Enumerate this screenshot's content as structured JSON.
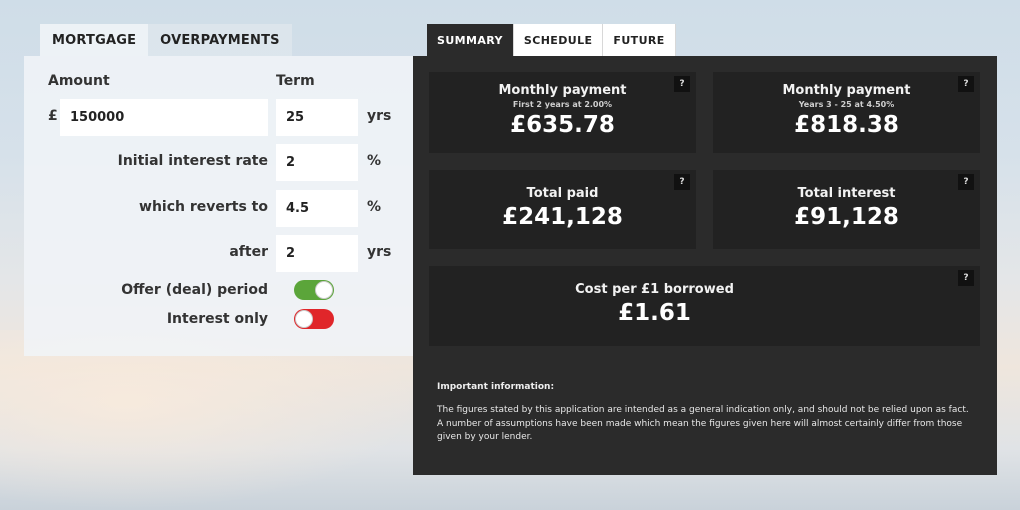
{
  "left_tabs": [
    {
      "label": "MORTGAGE",
      "active": true
    },
    {
      "label": "OVERPAYMENTS",
      "active": false
    }
  ],
  "form": {
    "amount_label": "Amount",
    "term_label": "Term",
    "currency_symbol": "£",
    "amount_value": "150000",
    "term_value": "25",
    "term_unit": "yrs",
    "initial_rate_label": "Initial interest rate",
    "initial_rate_value": "2",
    "initial_rate_unit": "%",
    "reverts_label": "which reverts to",
    "reverts_value": "4.5",
    "reverts_unit": "%",
    "after_label": "after",
    "after_value": "2",
    "after_unit": "yrs",
    "offer_label": "Offer (deal) period",
    "offer_on": true,
    "interest_only_label": "Interest only",
    "interest_only_on": false
  },
  "right_tabs": [
    {
      "label": "SUMMARY",
      "active": true
    },
    {
      "label": "SCHEDULE",
      "active": false
    },
    {
      "label": "FUTURE",
      "active": false
    }
  ],
  "summary": {
    "help": "?",
    "monthly_initial": {
      "title": "Monthly payment",
      "subtitle": "First 2 years at 2.00%",
      "value": "£635.78"
    },
    "monthly_revert": {
      "title": "Monthly payment",
      "subtitle": "Years 3 - 25 at 4.50%",
      "value": "£818.38"
    },
    "total_paid": {
      "title": "Total paid",
      "value": "£241,128"
    },
    "total_interest": {
      "title": "Total interest",
      "value": "£91,128"
    },
    "cost_per_pound": {
      "title": "Cost per £1 borrowed",
      "value": "£1.61"
    }
  },
  "info": {
    "heading": "Important information:",
    "body": "The figures stated by this application are intended as a general indication only, and should not be relied upon as fact. A number of assumptions have been made which mean the figures given here will almost certainly differ from those given by your lender."
  },
  "colors": {
    "toggle_on": "#5ba53a",
    "toggle_off": "#e0262a",
    "panel_dark": "#2b2b2b",
    "card_dark": "#222222"
  }
}
